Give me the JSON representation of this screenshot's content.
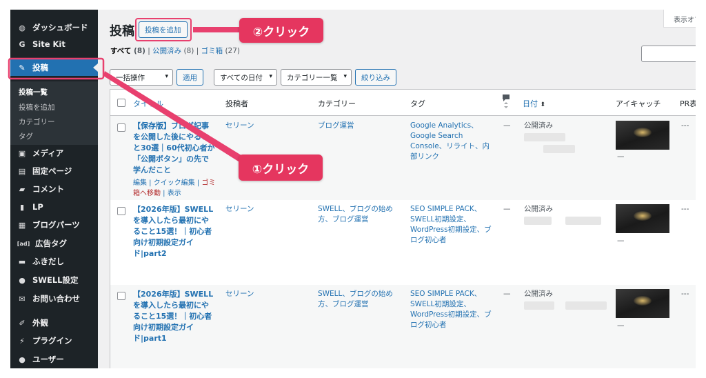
{
  "colors": {
    "accent": "#2271b1",
    "sidebar_bg": "#1d2327",
    "callout": "#e5365f"
  },
  "sidebar": {
    "items": [
      {
        "label": "ダッシュボード",
        "icon": "dashboard-icon",
        "glyph": "◍"
      },
      {
        "label": "Site Kit",
        "icon": "google-icon",
        "glyph": "G"
      },
      {
        "label": "投稿",
        "icon": "pin-icon",
        "glyph": "✎"
      },
      {
        "label": "メディア",
        "icon": "media-icon",
        "glyph": "▣"
      },
      {
        "label": "固定ページ",
        "icon": "page-icon",
        "glyph": "▤"
      },
      {
        "label": "コメント",
        "icon": "comment-icon",
        "glyph": "▰"
      },
      {
        "label": "LP",
        "icon": "document-icon",
        "glyph": "▮"
      },
      {
        "label": "ブログパーツ",
        "icon": "table-icon",
        "glyph": "▦"
      },
      {
        "label": "広告タグ",
        "icon": "ad-icon",
        "glyph": "[ad]"
      },
      {
        "label": "ふきだし",
        "icon": "speech-bubble-icon",
        "glyph": "▬"
      },
      {
        "label": "SWELL設定",
        "icon": "swell-icon",
        "glyph": "●"
      },
      {
        "label": "お問い合わせ",
        "icon": "mail-icon",
        "glyph": "✉"
      },
      {
        "label": "外観",
        "icon": "brush-icon",
        "glyph": "✐"
      },
      {
        "label": "プラグイン",
        "icon": "plugin-icon",
        "glyph": "⚡"
      },
      {
        "label": "ユーザー",
        "icon": "user-icon",
        "glyph": "●"
      }
    ],
    "submenu": [
      "投稿一覧",
      "投稿を追加",
      "カテゴリー",
      "タグ"
    ]
  },
  "header": {
    "title": "投稿",
    "add_new": "投稿を追加",
    "screen_options": "表示オプ"
  },
  "filters": {
    "all_label": "すべて",
    "all_count": "(8)",
    "published_label": "公開済み",
    "published_count": "(8)",
    "trash_label": "ゴミ箱",
    "trash_count": "(27)",
    "sep": "|"
  },
  "toolbar": {
    "bulk": "一括操作",
    "apply": "適用",
    "dates": "すべての日付",
    "categories": "カテゴリー一覧",
    "filter": "絞り込み",
    "chevron": "▾"
  },
  "table": {
    "headers": {
      "title": "タイトル",
      "author": "投稿者",
      "category": "カテゴリー",
      "tags": "タグ",
      "date": "日付",
      "eyecatch": "アイキャッチ",
      "pr": "PR表"
    },
    "rows": [
      {
        "title_lines": [
          "【保存版】ブログ記事",
          "を公開した後にやるこ",
          "と30選｜60代初心者が",
          "「公開ボタン」の先で",
          "学んだこと"
        ],
        "actions_1": "編集 | クイック編集 | ",
        "actions_trash_1": "ゴミ",
        "actions_trash_2": "箱へ移動",
        "actions_2": " | 表示",
        "author": "セリーン",
        "category_lines": [
          "ブログ運営"
        ],
        "tag_lines": [
          "Google Analytics、",
          "Google Search",
          "Console、リライト、内",
          "部リンク"
        ],
        "comments": "—",
        "status": "公開済み",
        "eyecatch_dash": "—",
        "pr": "---"
      },
      {
        "title_lines": [
          "【2026年版】SWELL",
          "を導入したら最初にや",
          "ること15選！｜初心者",
          "向け初期設定ガイ",
          "ド|part2"
        ],
        "author": "セリーン",
        "category_lines": [
          "SWELL、ブログの始め",
          "方、ブログ運営"
        ],
        "tag_lines": [
          "SEO SIMPLE PACK、",
          "SWELL初期設定、",
          "WordPress初期設定、ブ",
          "ログ初心者"
        ],
        "comments": "—",
        "status": "公開済み",
        "eyecatch_dash": "—",
        "pr": "---"
      },
      {
        "title_lines": [
          "【2026年版】SWELL",
          "を導入したら最初にや",
          "ること15選！｜初心者",
          "向け初期設定ガイ",
          "ド|part1"
        ],
        "author": "セリーン",
        "category_lines": [
          "SWELL、ブログの始め",
          "方、ブログ運営"
        ],
        "tag_lines": [
          "SEO SIMPLE PACK、",
          "SWELL初期設定、",
          "WordPress初期設定、ブ",
          "ログ初心者"
        ],
        "comments": "—",
        "status": "公開済み",
        "eyecatch_dash": "—",
        "pr": "---"
      }
    ]
  },
  "annotations": {
    "click_1": "①クリック",
    "click_2": "②クリック"
  }
}
